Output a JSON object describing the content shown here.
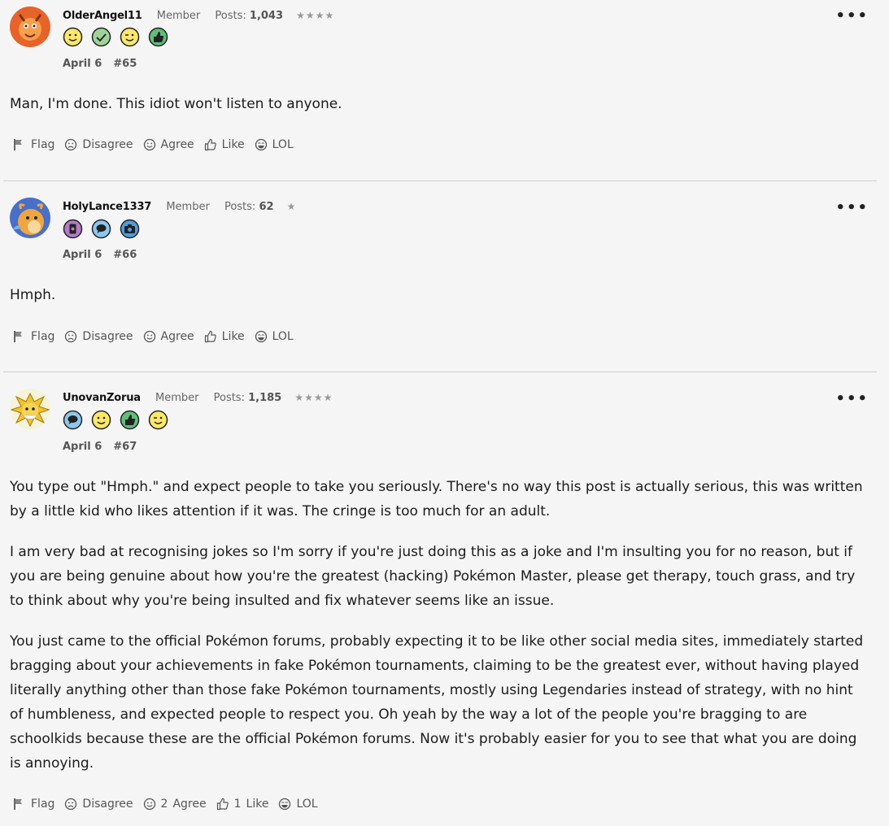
{
  "posts": [
    {
      "username": "OlderAngel11",
      "role": "Member",
      "posts_label": "Posts:",
      "posts_count": "1,043",
      "stars": "★★★★",
      "badges": [
        "smile-badge-icon",
        "check-badge-icon",
        "wink-badge-icon",
        "thumbs-up-badge-icon"
      ],
      "date": "April 6",
      "number": "#65",
      "paragraphs": [
        "Man, I'm done. This idiot won't listen to anyone."
      ],
      "actions": {
        "flag": "Flag",
        "disagree": "Disagree",
        "agree": "Agree",
        "agree_count": "",
        "like": "Like",
        "like_count": "",
        "lol": "LOL"
      }
    },
    {
      "username": "HolyLance1337",
      "role": "Member",
      "posts_label": "Posts:",
      "posts_count": "62",
      "stars": "★",
      "badges": [
        "card-badge-icon",
        "speech-badge-icon",
        "camera-badge-icon"
      ],
      "date": "April 6",
      "number": "#66",
      "paragraphs": [
        "Hmph."
      ],
      "actions": {
        "flag": "Flag",
        "disagree": "Disagree",
        "agree": "Agree",
        "agree_count": "",
        "like": "Like",
        "like_count": "",
        "lol": "LOL"
      }
    },
    {
      "username": "UnovanZorua",
      "role": "Member",
      "posts_label": "Posts:",
      "posts_count": "1,185",
      "stars": "★★★★",
      "badges": [
        "speech-badge-icon",
        "smile-badge-icon",
        "thumbs-up-badge-icon",
        "wink-badge-icon"
      ],
      "date": "April 6",
      "number": "#67",
      "paragraphs": [
        "You type out \"Hmph.\" and expect people to take you seriously. There's no way this post is actually serious, this was written by a little kid who likes attention if it was. The cringe is too much for an adult.",
        "I am very bad at recognising jokes so I'm sorry if you're just doing this as a joke and I'm insulting you for no reason, but if you are being genuine about how you're the greatest (hacking) Pokémon Master, please get therapy, touch grass, and try to think about why you're being insulted and fix whatever seems like an issue.",
        "You just came to the official Pokémon forums, probably expecting it to be like other social media sites, immediately started bragging about your achievements in fake Pokémon tournaments, claiming to be the greatest ever, without having played literally anything other than those fake Pokémon tournaments, mostly using Legendaries instead of strategy, with no hint of humbleness, and expected people to respect you. Oh yeah by the way a lot of the people you're bragging to are schoolkids because these are the official Pokémon forums. Now it's probably easier for you to see that what you are doing is annoying."
      ],
      "actions": {
        "flag": "Flag",
        "disagree": "Disagree",
        "agree": "Agree",
        "agree_count": "2",
        "like": "Like",
        "like_count": "1",
        "lol": "LOL"
      }
    }
  ],
  "more_label": "•••"
}
